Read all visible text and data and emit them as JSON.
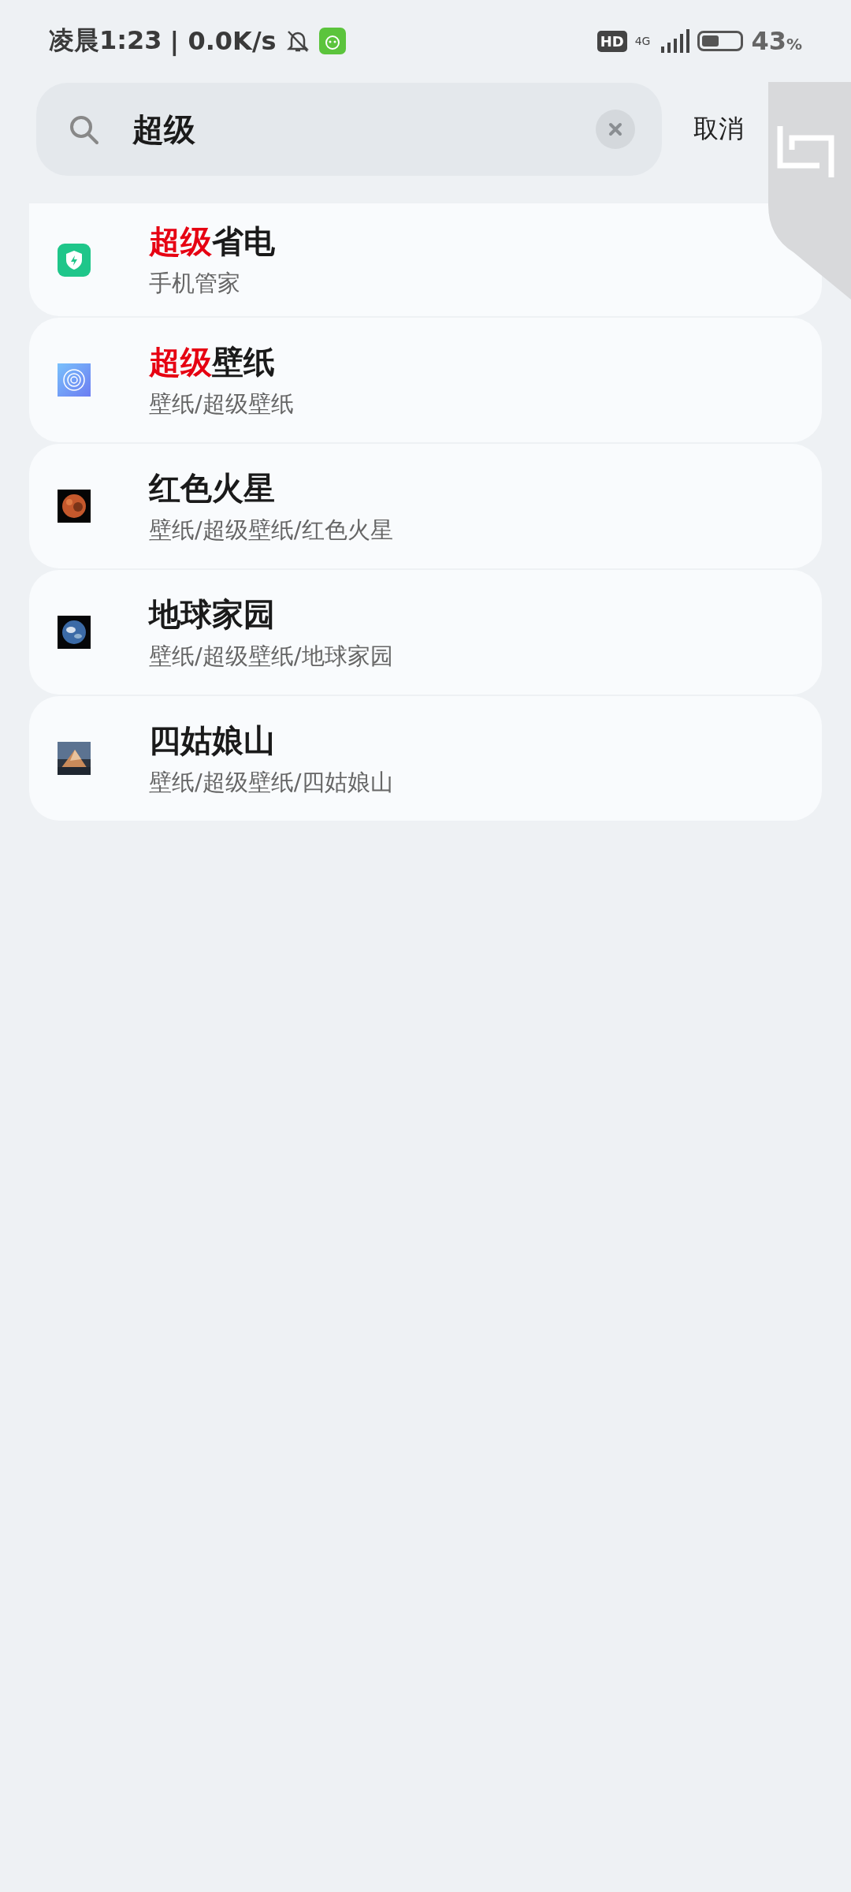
{
  "status_bar": {
    "time": "凌晨1:23",
    "speed": "| 0.0K/s",
    "hd": "HD",
    "network": "4G",
    "battery": "43",
    "battery_unit": "%"
  },
  "search": {
    "value": "超级",
    "cancel": "取消"
  },
  "results": [
    {
      "icon": {
        "kind": "app-shield"
      },
      "title_parts": [
        {
          "text": "超级",
          "highlighted": true
        },
        {
          "text": "省电",
          "highlighted": false
        }
      ],
      "path": "手机管家"
    },
    {
      "icon": {
        "kind": "app-orbit"
      },
      "title_parts": [
        {
          "text": "超级",
          "highlighted": true
        },
        {
          "text": "壁纸",
          "highlighted": false
        }
      ],
      "path": "壁纸/超级壁纸"
    },
    {
      "icon": {
        "kind": "picture"
      },
      "title_parts": [
        {
          "text": "红色火星",
          "highlighted": false
        }
      ],
      "path": "壁纸/超级壁纸/红色火星"
    },
    {
      "icon": {
        "kind": "picture"
      },
      "title_parts": [
        {
          "text": "地球家园",
          "highlighted": false
        }
      ],
      "path": "壁纸/超级壁纸/地球家园"
    },
    {
      "icon": {
        "kind": "picture"
      },
      "title_parts": [
        {
          "text": "四姑娘山",
          "highlighted": false
        }
      ],
      "path": "壁纸/超级壁纸/四姑娘山"
    }
  ]
}
